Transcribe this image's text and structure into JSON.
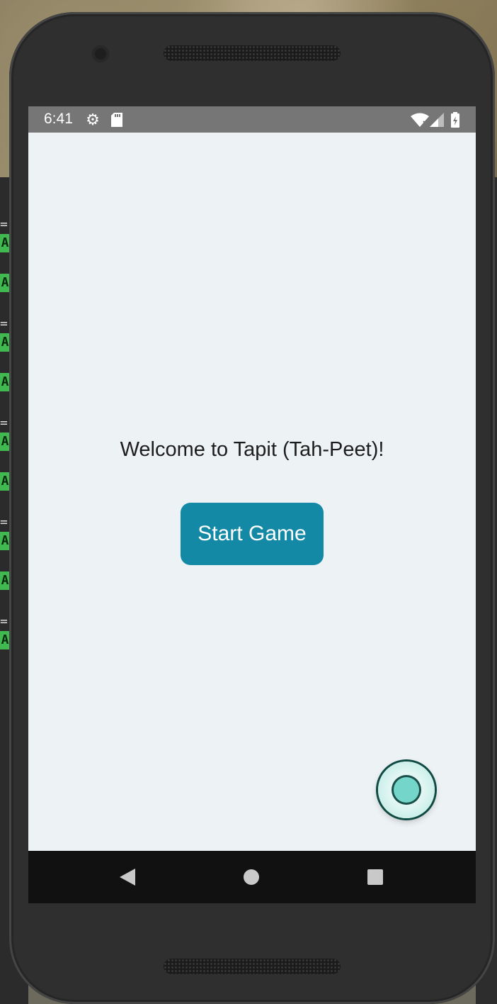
{
  "status_bar": {
    "time": "6:41",
    "icons": [
      "settings-icon",
      "sd-card-icon",
      "wifi-icon",
      "signal-icon",
      "battery-icon"
    ]
  },
  "main": {
    "welcome_text": "Welcome to Tapit (Tah-Peet)!",
    "start_button_label": "Start Game"
  },
  "nav_bar": {
    "buttons": [
      "back-icon",
      "home-icon",
      "recents-icon"
    ]
  },
  "colors": {
    "screen_background": "#edf2f5",
    "status_bar": "#767676",
    "accent_button": "#1389a6",
    "fab_fill": "#74d6cb",
    "nav_bar": "#111111"
  }
}
